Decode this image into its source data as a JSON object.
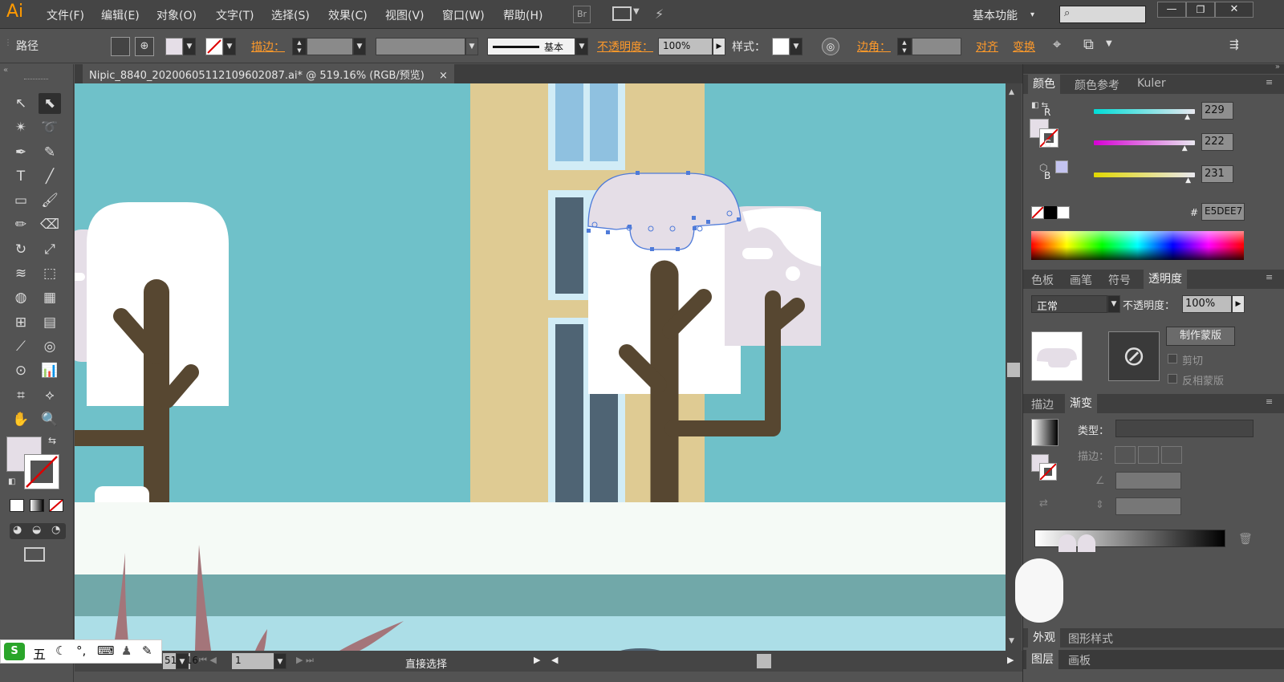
{
  "app": {
    "logo": "Ai",
    "workspace": "基本功能",
    "workspace_arrow": "▾"
  },
  "menu": [
    "文件(F)",
    "编辑(E)",
    "对象(O)",
    "文字(T)",
    "选择(S)",
    "效果(C)",
    "视图(V)",
    "窗口(W)",
    "帮助(H)"
  ],
  "menubar_icons": {
    "br": "Br"
  },
  "control": {
    "object_type": "路径",
    "stroke_label": "描边：",
    "brush_label": "基本",
    "opacity_label": "不透明度：",
    "opacity_value": "100%",
    "style_label": "样式：",
    "corner_label": "边角：",
    "align_label": "对齐",
    "transform_label": "变换"
  },
  "document": {
    "tab_title": "Nipic_8840_20200605112109602087.ai* @ 519.16% (RGB/预览)",
    "close": "×"
  },
  "color_panel": {
    "tabs": [
      "颜色",
      "颜色参考",
      "Kuler"
    ],
    "r_label": "R",
    "g_label": "G",
    "b_label": "B",
    "r": "229",
    "g": "222",
    "b": "231",
    "r_pct": 0.898,
    "g_pct": 0.871,
    "b_pct": 0.906,
    "hash": "#",
    "hex": "E5DEE7",
    "fill_color": "#e5dee7"
  },
  "transparency_panel": {
    "tabs": [
      "色板",
      "画笔",
      "符号",
      "透明度"
    ],
    "blend_mode": "正常",
    "opacity_label": "不透明度：",
    "opacity_value": "100%",
    "make_mask": "制作蒙版",
    "clip": "剪切",
    "invert": "反相蒙版"
  },
  "gradient_panel": {
    "tabs": [
      "描边",
      "渐变"
    ],
    "type_label": "类型：",
    "stroke_label": "描边："
  },
  "appearance_panel": {
    "tabs": [
      "外观",
      "图形样式"
    ]
  },
  "layers_panel": {
    "tabs": [
      "图层",
      "画板"
    ]
  },
  "status": {
    "zoom": "519.16",
    "artboard": "1",
    "tool": "直接选择"
  },
  "ime": {
    "label": "五"
  }
}
